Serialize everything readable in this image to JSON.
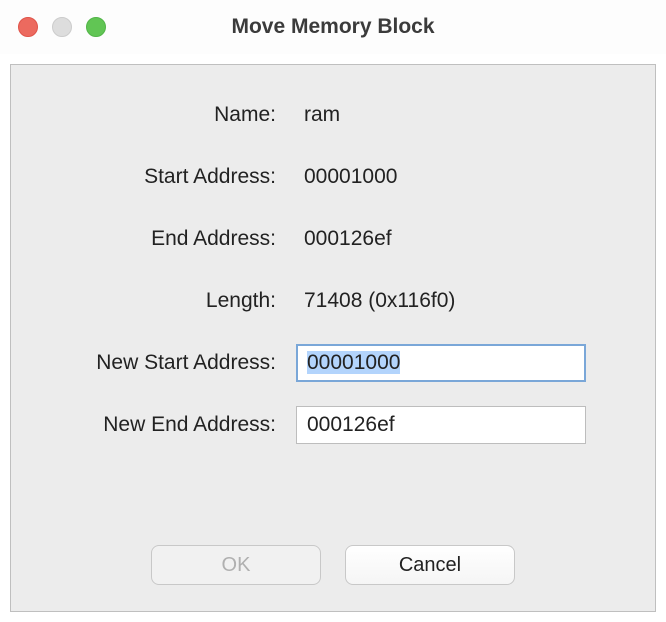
{
  "window": {
    "title": "Move Memory Block"
  },
  "form": {
    "name_label": "Name:",
    "name_value": "ram",
    "start_label": "Start Address:",
    "start_value": "00001000",
    "end_label": "End Address:",
    "end_value": "000126ef",
    "length_label": "Length:",
    "length_value": "71408  (0x116f0)",
    "newstart_label": "New Start Address:",
    "newstart_value": "00001000",
    "newend_label": "New End Address:",
    "newend_value": "000126ef"
  },
  "buttons": {
    "ok": "OK",
    "cancel": "Cancel"
  }
}
